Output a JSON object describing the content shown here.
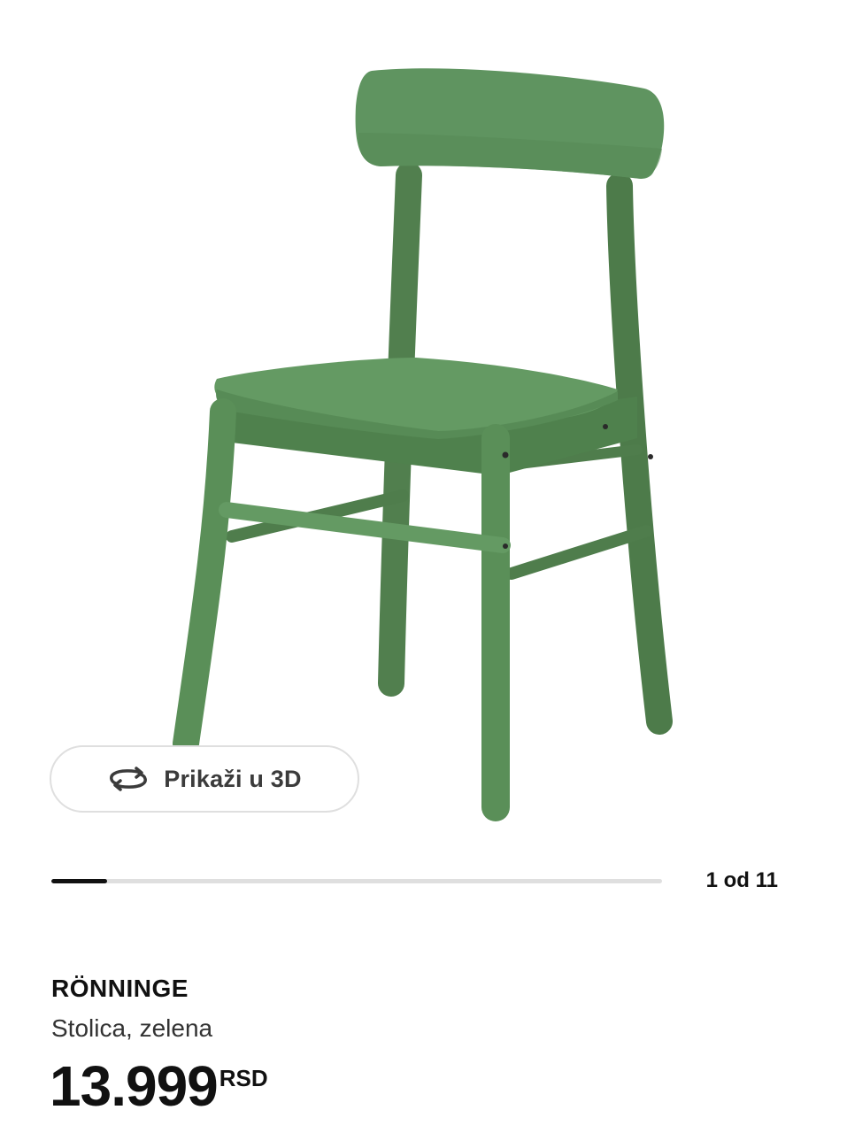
{
  "gallery": {
    "image_alt": "RÖNNINGE Stolica, zelena",
    "view3d_label": "Prikaži u 3D",
    "progress": {
      "current": 1,
      "total": 11
    },
    "counter_text": "1 od 11"
  },
  "product": {
    "name": "RÖNNINGE",
    "description": "Stolica, zelena",
    "price": "13.999",
    "currency": "RSD"
  },
  "colors": {
    "chair_green": "#5f8f5b",
    "text": "#111111",
    "border": "#dfdfdf"
  },
  "icons": [
    "rotate-3d-icon"
  ]
}
